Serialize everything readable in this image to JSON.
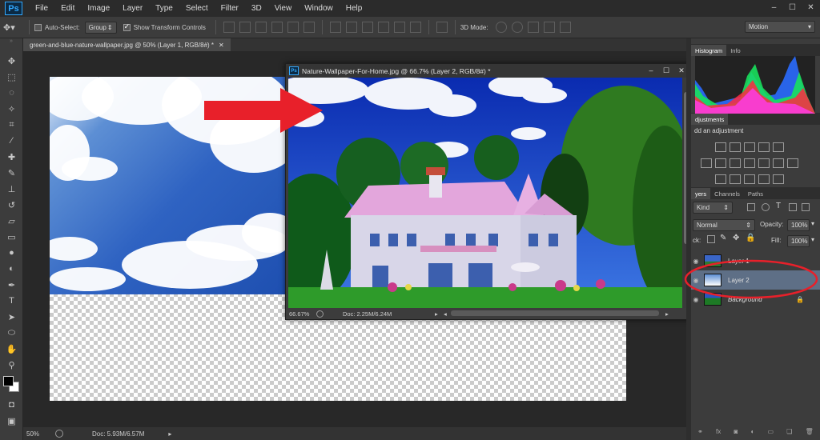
{
  "app": {
    "logo": "Ps"
  },
  "menu": [
    "File",
    "Edit",
    "Image",
    "Layer",
    "Type",
    "Select",
    "Filter",
    "3D",
    "View",
    "Window",
    "Help"
  ],
  "window_controls": [
    "–",
    "☐",
    "✕"
  ],
  "options": {
    "auto_select_label": "Auto-Select:",
    "auto_select_value": "Group",
    "show_transform_label": "Show Transform Controls",
    "mode_3d_label": "3D Mode:",
    "workspace": "Motion"
  },
  "doc1": {
    "tab": "green-and-blue-nature-wallpaper.jpg @ 50% (Layer 1, RGB/8#) *",
    "zoom": "50%",
    "docinfo": "Doc: 5.93M/6.57M"
  },
  "doc2": {
    "title": "Nature-Wallpaper-For-Home.jpg @ 66.7% (Layer 2, RGB/8#) *",
    "zoom": "66.67%",
    "docinfo": "Doc: 2.25M/6.24M"
  },
  "panels": {
    "histogram_tabs": [
      "Histogram",
      "Info"
    ],
    "adjustments_tab": "djustments",
    "adjustments_hint": "dd an adjustment",
    "layers_tabs": [
      "yers",
      "Channels",
      "Paths"
    ],
    "kind": "Kind",
    "blend_mode": "Normal",
    "opacity_label": "Opacity:",
    "opacity_value": "100%",
    "lock_label": "ck:",
    "fill_label": "Fill:",
    "fill_value": "100%"
  },
  "layers": [
    {
      "name": "Layer 1"
    },
    {
      "name": "Layer 2",
      "selected": true
    },
    {
      "name": "Background",
      "locked": true
    }
  ],
  "colors": {
    "accent_red": "#e8202a",
    "ps_blue": "#31a8ff"
  }
}
